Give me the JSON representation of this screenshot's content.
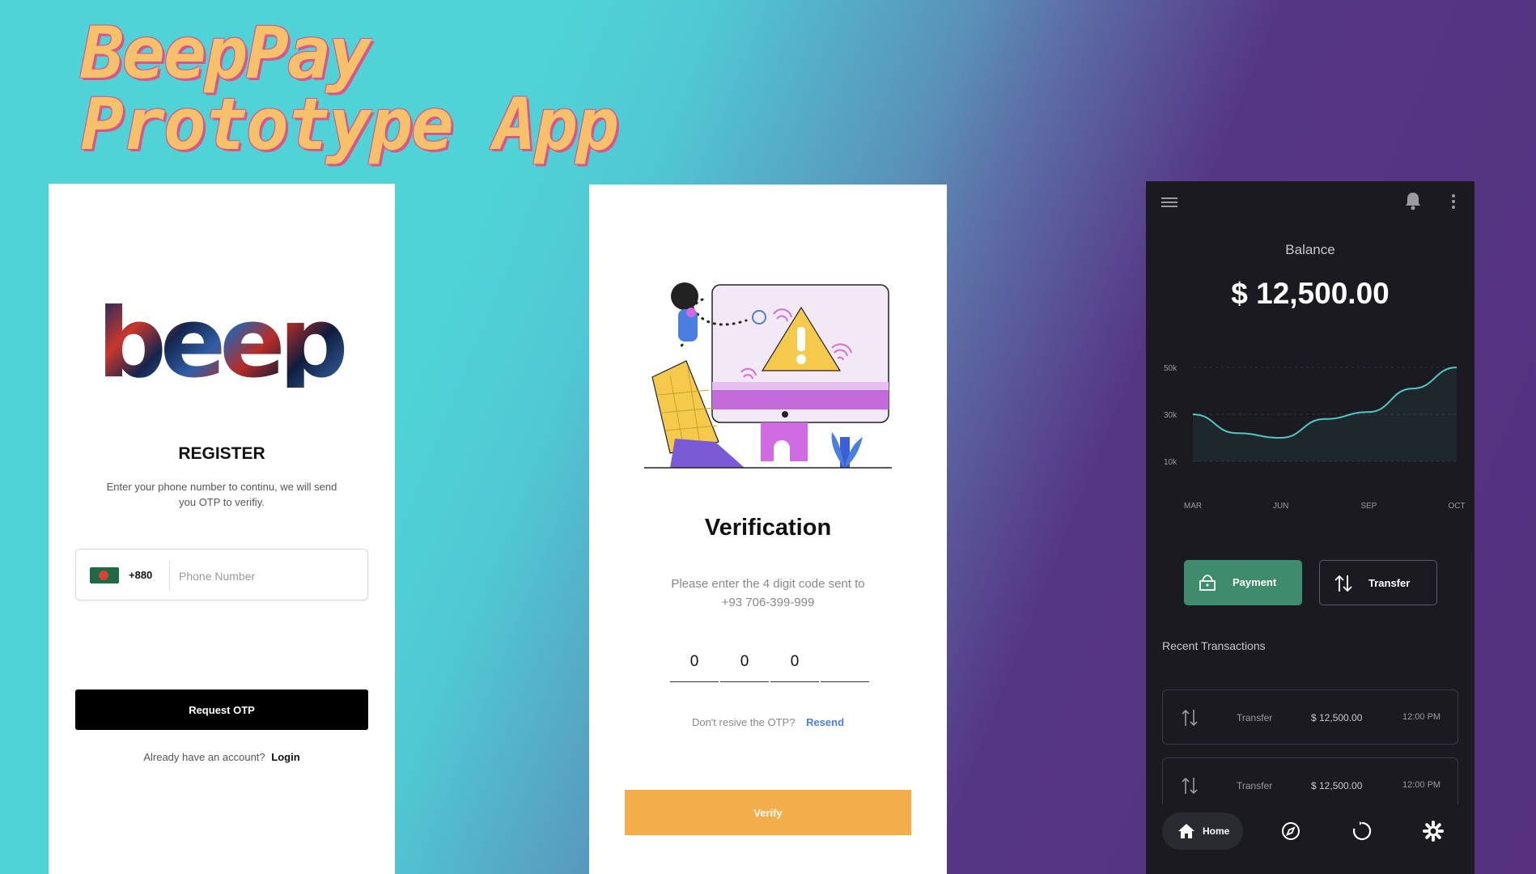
{
  "headline": {
    "line1": "BeepPay",
    "line2": "Prototype App"
  },
  "register": {
    "logo_text": "beep",
    "title": "REGISTER",
    "description": "Enter your phone number to continu, we will send you OTP to verifiy.",
    "dial_code": "+880",
    "phone_placeholder": "Phone Number",
    "phone_value": "",
    "request_button": "Request OTP",
    "account_text": "Already have an account?",
    "login_link": "Login"
  },
  "verification": {
    "title": "Verification",
    "description_line1": "Please enter the 4 digit code sent to",
    "description_line2": "+93 706-399-999",
    "otp_digits": [
      "0",
      "0",
      "0",
      ""
    ],
    "resend_text": "Don't resive the OTP?",
    "resend_link": "Resend",
    "verify_button": "Verify"
  },
  "dashboard": {
    "balance_label": "Balance",
    "balance_value": "$ 12,500.00",
    "payment_button": "Payment",
    "transfer_button": "Transfer",
    "recent_title": "Recent Transactions",
    "transactions": [
      {
        "type": "Transfer",
        "amount": "$ 12,500.00",
        "time": "12:00 PM"
      },
      {
        "type": "Transfer",
        "amount": "$ 12,500.00",
        "time": "12:00 PM"
      }
    ],
    "nav": {
      "home_label": "Home"
    }
  },
  "chart_data": {
    "type": "area",
    "x": [
      "MAR",
      "",
      "JUN",
      "",
      "SEP",
      "",
      "OCT"
    ],
    "values": [
      30,
      22,
      20,
      28,
      31,
      41,
      50
    ],
    "y_ticks": [
      "50k",
      "30k",
      "10k"
    ],
    "ylim": [
      10,
      50
    ],
    "colors": {
      "line": "#4fc7c2",
      "fill": "#4fc7c2"
    },
    "grid": true
  },
  "colors": {
    "accent_green": "#3f8c6d",
    "accent_orange": "#f3ad4a",
    "link_blue": "#4a7fe0",
    "dark_bg": "#1a1a20"
  }
}
